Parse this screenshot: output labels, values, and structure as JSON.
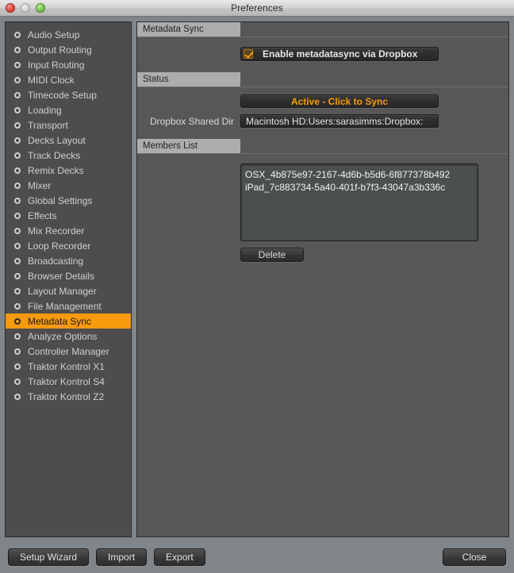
{
  "window": {
    "title": "Preferences",
    "traffic_lights": [
      "close-light",
      "minimize-light",
      "zoom-light"
    ]
  },
  "sidebar": {
    "items": [
      {
        "label": "Audio Setup",
        "selected": false
      },
      {
        "label": "Output Routing",
        "selected": false
      },
      {
        "label": "Input Routing",
        "selected": false
      },
      {
        "label": "MIDI Clock",
        "selected": false
      },
      {
        "label": "Timecode Setup",
        "selected": false
      },
      {
        "label": "Loading",
        "selected": false
      },
      {
        "label": "Transport",
        "selected": false
      },
      {
        "label": "Decks Layout",
        "selected": false
      },
      {
        "label": "Track Decks",
        "selected": false
      },
      {
        "label": "Remix Decks",
        "selected": false
      },
      {
        "label": "Mixer",
        "selected": false
      },
      {
        "label": "Global Settings",
        "selected": false
      },
      {
        "label": "Effects",
        "selected": false
      },
      {
        "label": "Mix Recorder",
        "selected": false
      },
      {
        "label": "Loop Recorder",
        "selected": false
      },
      {
        "label": "Broadcasting",
        "selected": false
      },
      {
        "label": "Browser Details",
        "selected": false
      },
      {
        "label": "Layout Manager",
        "selected": false
      },
      {
        "label": "File Management",
        "selected": false
      },
      {
        "label": "Metadata Sync",
        "selected": true
      },
      {
        "label": "Analyze Options",
        "selected": false
      },
      {
        "label": "Controller Manager",
        "selected": false
      },
      {
        "label": "Traktor Kontrol X1",
        "selected": false
      },
      {
        "label": "Traktor Kontrol S4",
        "selected": false
      },
      {
        "label": "Traktor Kontrol Z2",
        "selected": false
      }
    ]
  },
  "content": {
    "metadata_sync": {
      "header": "Metadata Sync",
      "enable_checkbox": {
        "label": "Enable metadatasync via Dropbox",
        "checked": true
      }
    },
    "status": {
      "header": "Status",
      "sync_button_label": "Active - Click to Sync",
      "shared_dir": {
        "label": "Dropbox Shared Dir",
        "value": "Macintosh HD:Users:sarasimms:Dropbox:"
      }
    },
    "members_list": {
      "header": "Members List",
      "members": [
        "OSX_4b875e97-2167-4d6b-b5d6-6f877378b492",
        "iPad_7c883734-5a40-401f-b7f3-43047a3b336c"
      ],
      "delete_button_label": "Delete"
    }
  },
  "toolbar": {
    "setup_wizard_label": "Setup Wizard",
    "import_label": "Import",
    "export_label": "Export",
    "close_label": "Close"
  },
  "colors": {
    "accent_orange": "#f79a0e",
    "panel_bg": "#575757",
    "sidebar_bg": "#4d4d4d",
    "chrome_gray": "#808589",
    "section_tab": "#abadae"
  }
}
